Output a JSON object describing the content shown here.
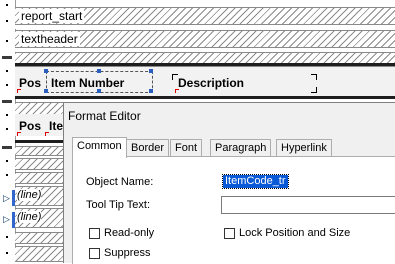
{
  "bands": {
    "report_start": "report_start",
    "textheader": "textheader"
  },
  "header": {
    "pos": "Pos",
    "item_number": "Item Number",
    "description": "Description"
  },
  "under_dialog": {
    "pos": "Pos",
    "item_partial": "Ite",
    "line_a": "line)",
    "line_b": "line)",
    "cursor_a": "(",
    "cursor_b": "(",
    "ruler_arrow_a": "▷",
    "ruler_arrow_b": "▷"
  },
  "dialog": {
    "title": "Format Editor",
    "tabs": [
      "Common",
      "Border",
      "Font",
      "Paragraph",
      "Hyperlink"
    ],
    "active_tab": "Common",
    "object_name_label": "Object Name:",
    "object_name_value": "ItemCode_tr",
    "tooltip_label": "Tool Tip Text:",
    "tooltip_value": "",
    "readonly_label": "Read-only",
    "lock_label": "Lock Position and Size",
    "suppress_label": "Suppress"
  },
  "colors": {
    "selection": "#0a5ad7",
    "ruler_accent": "#3366cc",
    "dialog_bg": "#f0f0f0"
  }
}
